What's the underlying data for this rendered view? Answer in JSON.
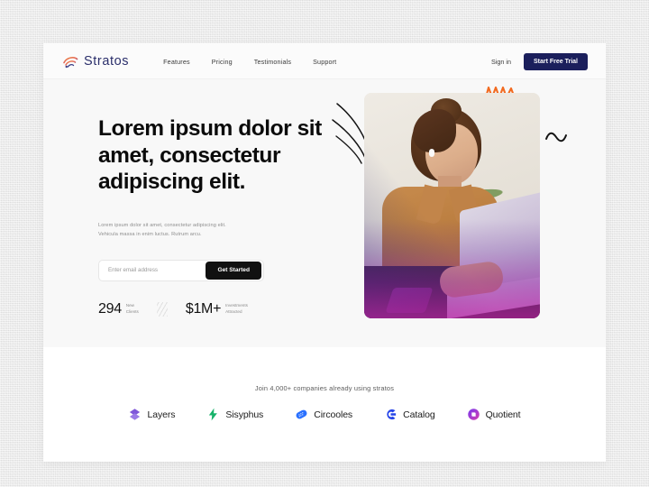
{
  "brand": {
    "name": "Stratos",
    "logo_icon": "wifi-bird-icon",
    "logo_color_start": "#f08a3c",
    "logo_color_end": "#2b2f6b",
    "name_color": "#2b2f6b"
  },
  "nav": {
    "links": [
      {
        "label": "Features"
      },
      {
        "label": "Pricing"
      },
      {
        "label": "Testimonials"
      },
      {
        "label": "Support"
      }
    ],
    "sign_in_label": "Sign in",
    "cta_label": "Start Free Trial",
    "cta_color": "#1b1f5c"
  },
  "hero": {
    "headline": "Lorem ipsum dolor sit\namet, consectetur\nadipiscing elit.",
    "subtext": "Lorem ipsum dolor sit amet, consectetur adipiscing elit.\nVehicula massa in enim luctus. Rutrum arcu.",
    "email_placeholder": "Enter email address",
    "email_value": "",
    "get_started_label": "Get Started",
    "get_started_color": "#111111",
    "stats": [
      {
        "number": "294",
        "label": "New\nClients"
      },
      {
        "number": "$1M+",
        "label": "Investments\nAttracted"
      }
    ],
    "image": {
      "alt": "woman with earbuds working on a laptop",
      "gradient_overlay": "#c428aa",
      "decorations": [
        {
          "name": "arc-lines-decoration",
          "color": "#111111"
        },
        {
          "name": "orange-squiggle-decoration",
          "color": "#f26b21"
        },
        {
          "name": "black-tilde-decoration",
          "color": "#111111"
        }
      ]
    },
    "background": "#f8f8f8"
  },
  "logos": {
    "heading": "Join 4,000+ companies already using stratos",
    "items": [
      {
        "name": "Layers",
        "icon": "layers-diamond-icon",
        "color": "#7f56d9"
      },
      {
        "name": "Sisyphus",
        "icon": "lightning-bolt-icon",
        "color": "#17b26a"
      },
      {
        "name": "Circooles",
        "icon": "dotted-capsule-icon",
        "color": "#2970ff"
      },
      {
        "name": "Catalog",
        "icon": "c-ring-icon",
        "color": "#2443e8"
      },
      {
        "name": "Quotient",
        "icon": "circle-q-icon",
        "color": "#7839ee"
      }
    ]
  }
}
